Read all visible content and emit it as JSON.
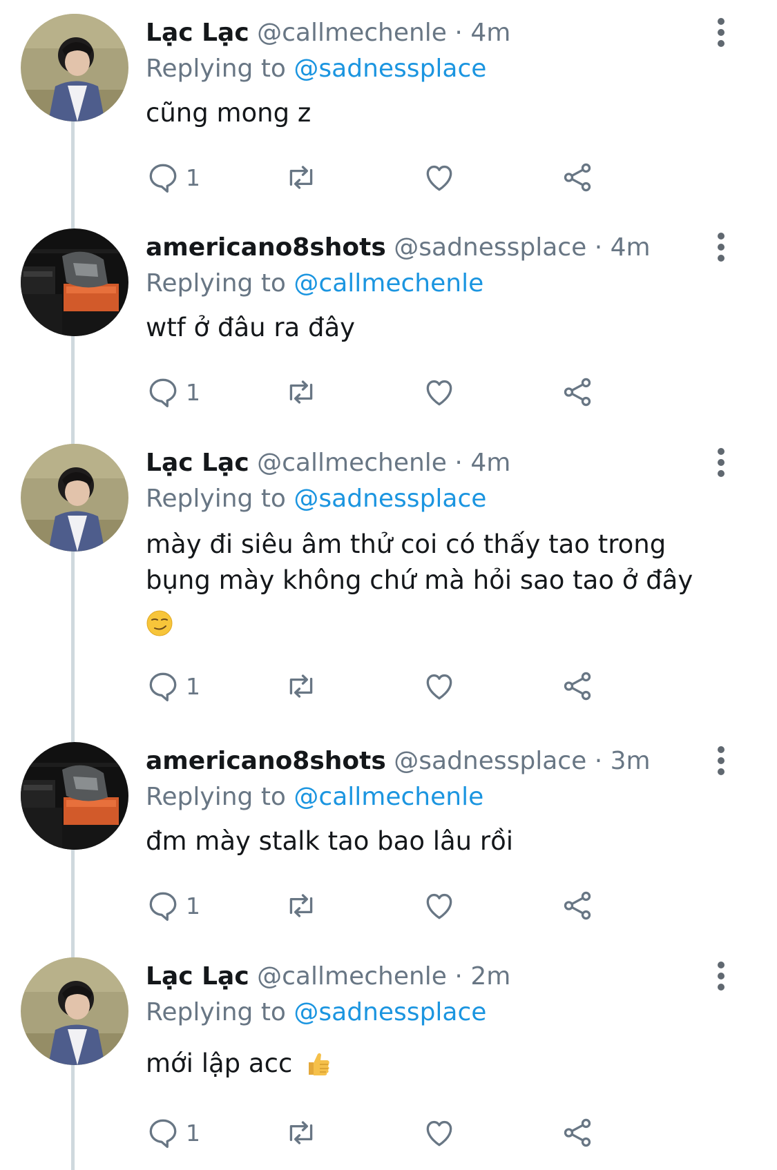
{
  "tweets": [
    {
      "name": "Lạc Lạc",
      "handle": "@callmechenle",
      "time": "4m",
      "replying_label": "Replying to",
      "replying_to": "@sadnessplace",
      "text": "cũng mong z",
      "reply_count": "1",
      "avatar": "lac"
    },
    {
      "name": "americano8shots",
      "handle": "@sadnessplace",
      "time": "4m",
      "replying_label": "Replying to",
      "replying_to": "@callmechenle",
      "text": "wtf ở đâu ra đây",
      "reply_count": "1",
      "avatar": "americano"
    },
    {
      "name": "Lạc Lạc",
      "handle": "@callmechenle",
      "time": "4m",
      "replying_label": "Replying to",
      "replying_to": "@sadnessplace",
      "text_line1": "mày đi siêu âm thử coi có thấy tao trong",
      "text_line2": "bụng mày không chứ mà hỏi sao tao ở đây",
      "emoji": "smirking-face-emoji",
      "reply_count": "1",
      "avatar": "lac"
    },
    {
      "name": "americano8shots",
      "handle": "@sadnessplace",
      "time": "3m",
      "replying_label": "Replying to",
      "replying_to": "@callmechenle",
      "text": "đm mày stalk tao bao lâu rồi",
      "reply_count": "1",
      "avatar": "americano"
    },
    {
      "name": "Lạc Lạc",
      "handle": "@callmechenle",
      "time": "2m",
      "replying_label": "Replying to",
      "replying_to": "@sadnessplace",
      "text": "mới lập acc",
      "emoji": "thumbs-up-emoji",
      "reply_count": "1",
      "avatar": "lac"
    }
  ],
  "separator": "·",
  "colors": {
    "name": "#14171a",
    "meta": "#687684",
    "link": "#1b95e0",
    "thread_line": "#cfd9de",
    "icon": "#687684"
  },
  "icons": [
    "reply-icon",
    "retweet-icon",
    "like-icon",
    "share-icon",
    "more-icon"
  ]
}
